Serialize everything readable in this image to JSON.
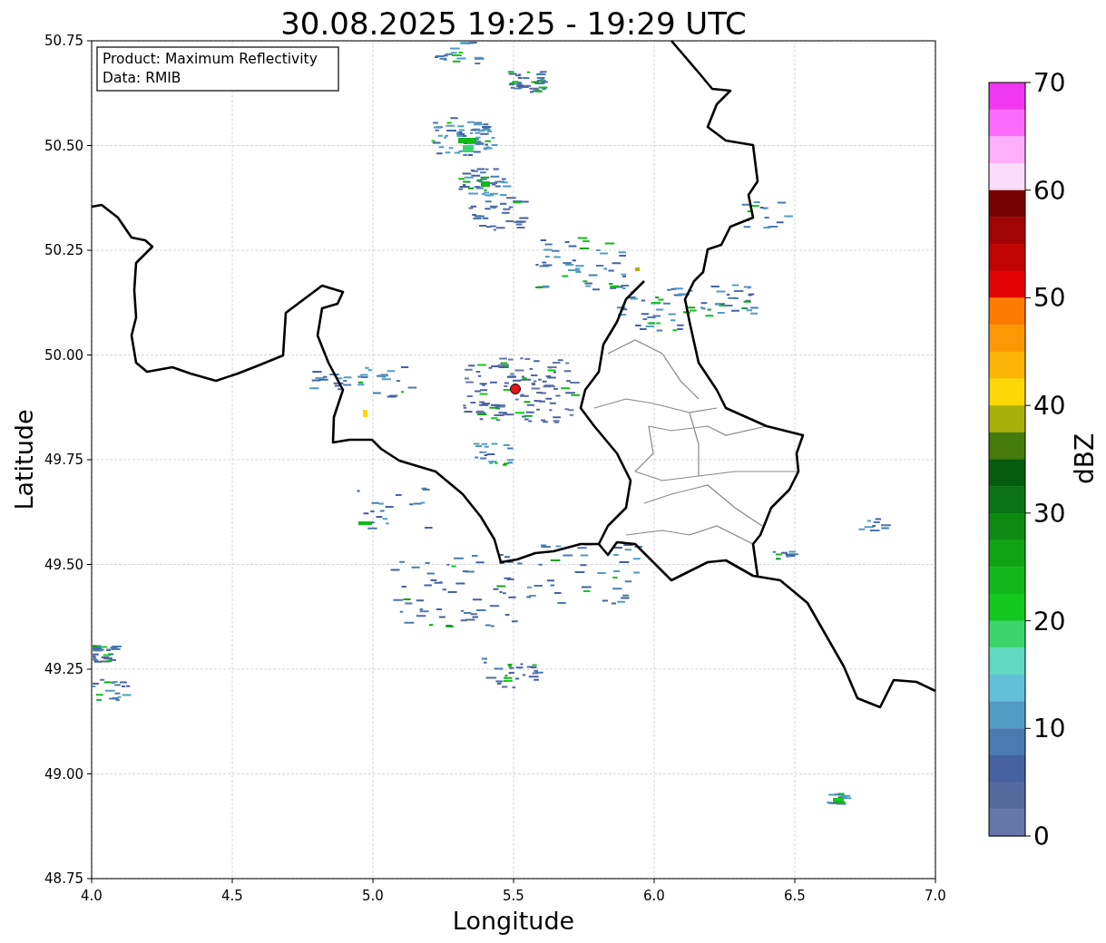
{
  "title": "30.08.2025 19:25 - 19:29 UTC",
  "legend": [
    "Product: Maximum Reflectivity",
    "Data: RMIB"
  ],
  "x_axis": {
    "label": "Longitude",
    "ticks": [
      "4.0",
      "4.5",
      "5.0",
      "5.5",
      "6.0",
      "6.5",
      "7.0"
    ]
  },
  "y_axis": {
    "label": "Latitude",
    "ticks": [
      "50.75",
      "50.50",
      "50.25",
      "50.00",
      "49.75",
      "49.50",
      "49.25",
      "49.00",
      "48.75"
    ]
  },
  "colorbar": {
    "label": "dBZ",
    "ticks": [
      "70",
      "60",
      "50",
      "40",
      "30",
      "20",
      "10",
      "0"
    ],
    "bands": [
      {
        "color": "#f038f0"
      },
      {
        "color": "#fc6cfc"
      },
      {
        "color": "#fcb0fc"
      },
      {
        "color": "#fcdcfc"
      },
      {
        "color": "#780202"
      },
      {
        "color": "#a00404"
      },
      {
        "color": "#c00404"
      },
      {
        "color": "#e40404"
      },
      {
        "color": "#fc7c02"
      },
      {
        "color": "#fc9806"
      },
      {
        "color": "#fcb406"
      },
      {
        "color": "#fcd806"
      },
      {
        "color": "#aab00a"
      },
      {
        "color": "#467a0a"
      },
      {
        "color": "#065c0e"
      },
      {
        "color": "#0a7414"
      },
      {
        "color": "#0e8a12"
      },
      {
        "color": "#10a414"
      },
      {
        "color": "#12b81a"
      },
      {
        "color": "#14c81e"
      },
      {
        "color": "#3cd46c"
      },
      {
        "color": "#60d8c2"
      },
      {
        "color": "#63c0da"
      },
      {
        "color": "#519cc4"
      },
      {
        "color": "#4a7bb0"
      },
      {
        "color": "#4561a0"
      },
      {
        "color": "#56699f"
      },
      {
        "color": "#6577a8"
      }
    ]
  }
}
